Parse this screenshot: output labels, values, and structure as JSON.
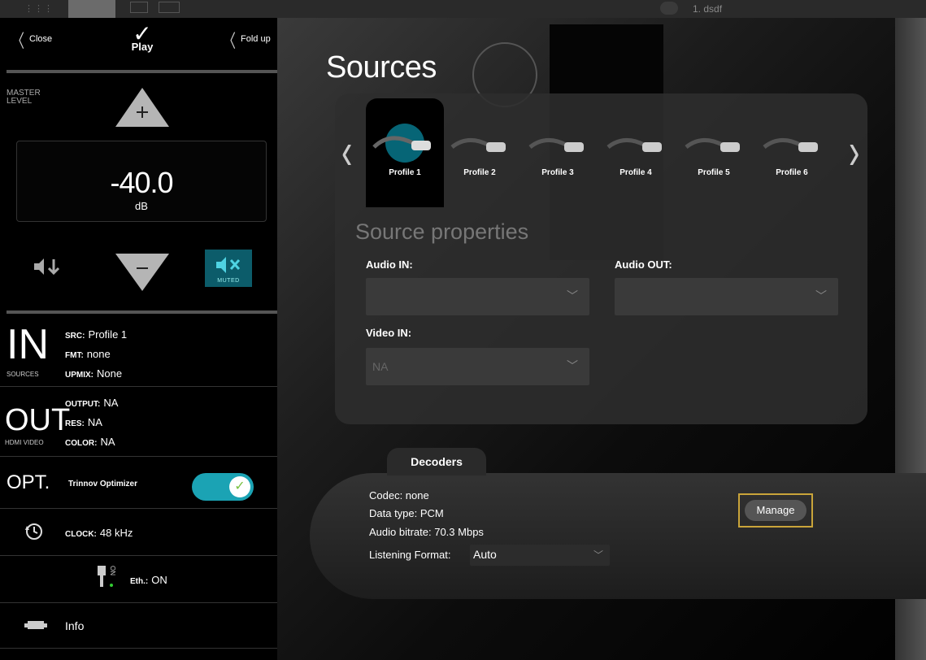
{
  "topbar": {
    "preset_name": "1. dsdf"
  },
  "sidebar": {
    "close_label": "Close",
    "fold_up_label": "Fold up",
    "logo_text": "Play",
    "master_label_1": "MASTER",
    "master_label_2": "LEVEL",
    "level_value": "-40.0",
    "level_unit": "dB",
    "mute_label": "MUTED",
    "in": {
      "big": "IN",
      "caption": "SOURCES",
      "src_key": "SRC:",
      "src_val": "Profile 1",
      "fmt_key": "FMT:",
      "fmt_val": "none",
      "upmix_key": "UPMIX:",
      "upmix_val": "None"
    },
    "out": {
      "big": "OUT",
      "caption": "HDMI VIDEO",
      "output_key": "OUTPUT:",
      "output_val": "NA",
      "res_key": "RES:",
      "res_val": "NA",
      "color_key": "COLOR:",
      "color_val": "NA"
    },
    "opt": {
      "big": "OPT.",
      "label": "Trinnov Optimizer",
      "enabled": true
    },
    "clock": {
      "key": "CLOCK:",
      "val": "48 kHz"
    },
    "eth": {
      "status_small": "ON",
      "key": "Eth.:",
      "val": "ON"
    },
    "info_label": "Info"
  },
  "main": {
    "title": "Sources",
    "profiles": [
      {
        "label": "Profile 1",
        "selected": true
      },
      {
        "label": "Profile 2",
        "selected": false
      },
      {
        "label": "Profile 3",
        "selected": false
      },
      {
        "label": "Profile 4",
        "selected": false
      },
      {
        "label": "Profile 5",
        "selected": false
      },
      {
        "label": "Profile 6",
        "selected": false
      }
    ],
    "props_title": "Source properties",
    "audio_in_label": "Audio IN:",
    "audio_in_value": "",
    "audio_out_label": "Audio OUT:",
    "audio_out_value": "",
    "video_in_label": "Video IN:",
    "video_in_value": "NA",
    "decoders": {
      "tab_label": "Decoders",
      "codec": "Codec: none",
      "data_type": "Data type: PCM",
      "bitrate": "Audio bitrate: 70.3 Mbps",
      "listening_label": "Listening Format:",
      "listening_value": "Auto",
      "manage_label": "Manage"
    }
  },
  "colors": {
    "accent_teal": "#1ba3b4",
    "mute_bg": "#0c5c6a",
    "highlight_gold": "#c9a43a"
  }
}
